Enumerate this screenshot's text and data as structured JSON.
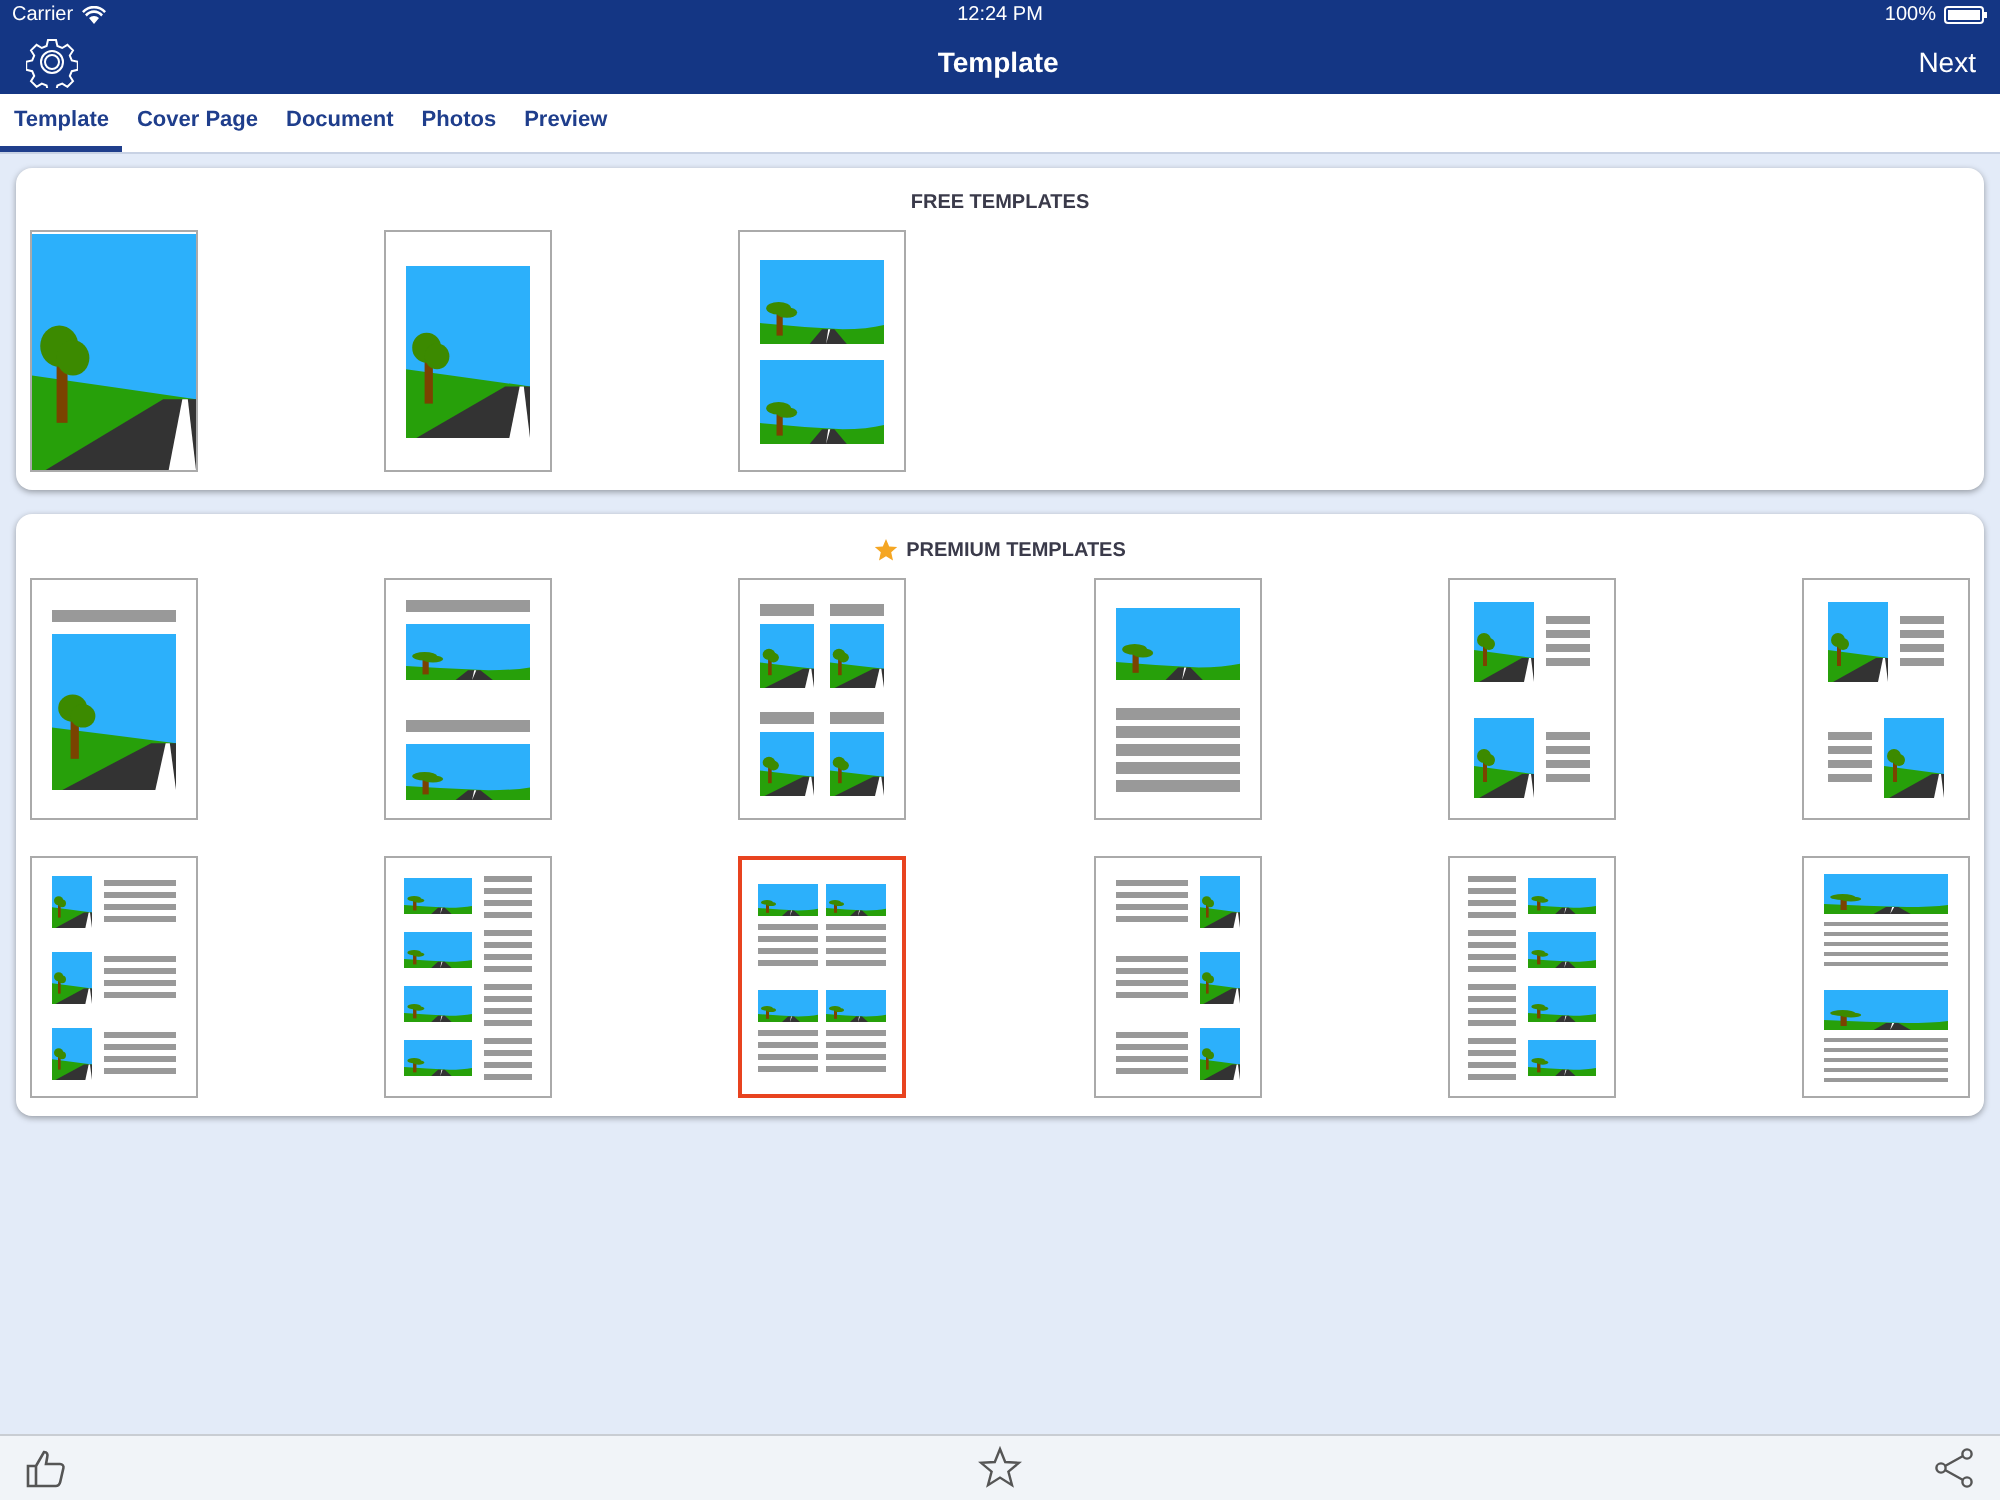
{
  "status_bar": {
    "carrier": "Carrier",
    "time": "12:24 PM",
    "battery": "100%"
  },
  "nav_bar": {
    "title": "Template",
    "right_button": "Next"
  },
  "tabs": [
    {
      "label": "Template",
      "selected": true
    },
    {
      "label": "Cover Page",
      "selected": false
    },
    {
      "label": "Document",
      "selected": false
    },
    {
      "label": "Photos",
      "selected": false
    },
    {
      "label": "Preview",
      "selected": false
    }
  ],
  "free_templates": {
    "title": "FREE TEMPLATES",
    "templates": [
      {
        "kind": "full-bleed",
        "selected": false
      },
      {
        "kind": "single",
        "selected": false
      },
      {
        "kind": "two-stacked",
        "selected": false
      }
    ]
  },
  "premium_templates": {
    "title": "PREMIUM TEMPLATES",
    "templates": [
      {
        "kind": "title-photo",
        "selected": false
      },
      {
        "kind": "two-titled-wide",
        "selected": false
      },
      {
        "kind": "four-titled",
        "selected": false
      },
      {
        "kind": "wide-photo-text",
        "selected": false
      },
      {
        "kind": "two-photo-text",
        "selected": false
      },
      {
        "kind": "alternating",
        "selected": false
      },
      {
        "kind": "three-photo-text",
        "selected": false
      },
      {
        "kind": "four-photo-text",
        "selected": false
      },
      {
        "kind": "four-grid-text",
        "selected": true
      },
      {
        "kind": "three-text-photo",
        "selected": false
      },
      {
        "kind": "four-text-photo",
        "selected": false
      },
      {
        "kind": "two-wide-text",
        "selected": false
      }
    ]
  }
}
